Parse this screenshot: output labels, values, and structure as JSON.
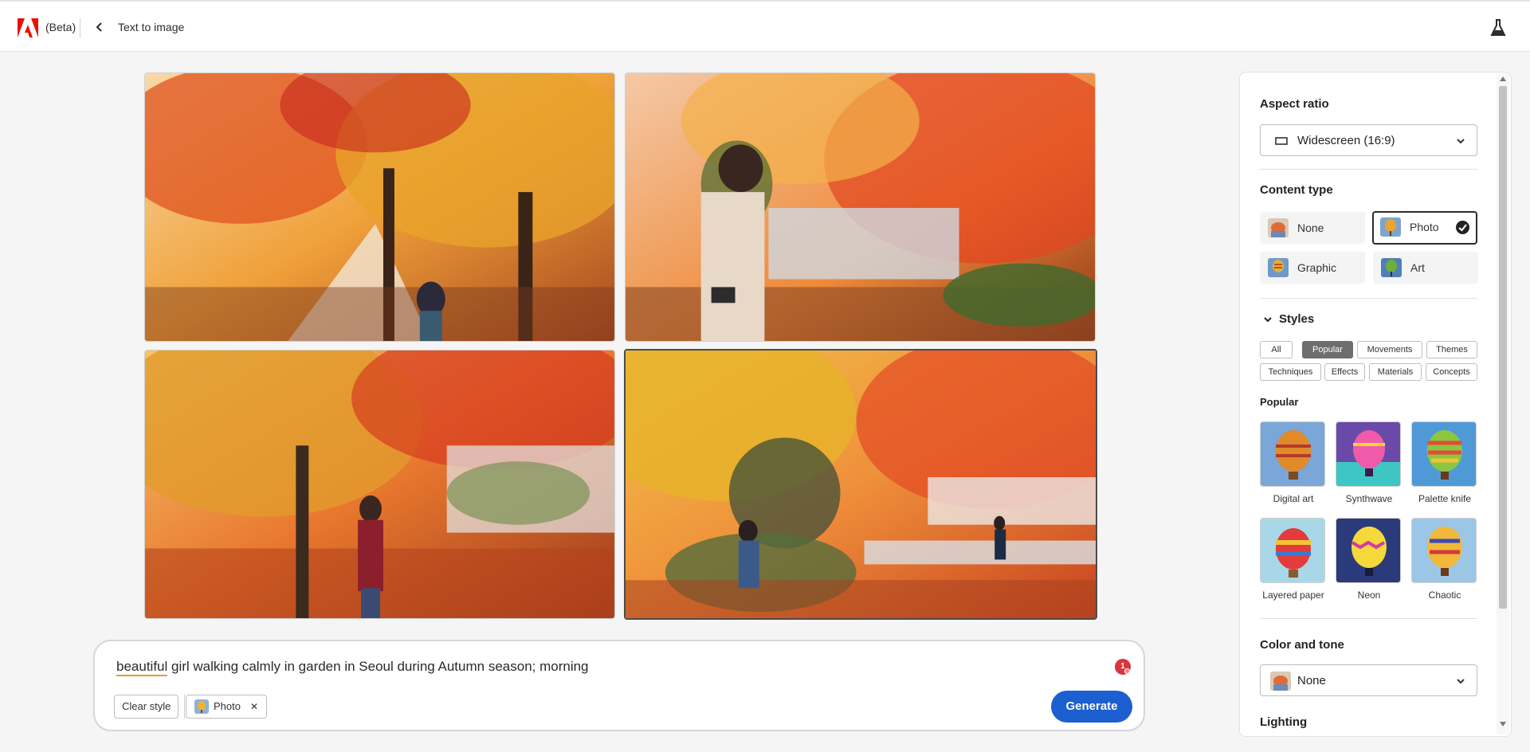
{
  "header": {
    "beta_label": "(Beta)",
    "page_title": "Text to image"
  },
  "gallery": {
    "images": [
      {
        "alt": "Autumn garden with woman among maple trees"
      },
      {
        "alt": "Woman with camera in autumn park"
      },
      {
        "alt": "Woman walking under red and orange maple trees"
      },
      {
        "alt": "Girl with backpack in autumn garden"
      }
    ]
  },
  "prompt": {
    "text_underlined": "beautiful",
    "text_rest": " girl walking calmly in garden in Seoul during Autumn season; morning",
    "notification_count": "1",
    "clear_style_label": "Clear style",
    "chip_photo_label": "Photo",
    "generate_label": "Generate"
  },
  "panel": {
    "aspect_ratio": {
      "title": "Aspect ratio",
      "value": "Widescreen (16:9)"
    },
    "content_type": {
      "title": "Content type",
      "options": [
        {
          "label": "None"
        },
        {
          "label": "Photo",
          "selected": true
        },
        {
          "label": "Graphic"
        },
        {
          "label": "Art"
        }
      ]
    },
    "styles": {
      "title": "Styles",
      "filters": [
        "All",
        "Popular",
        "Movements",
        "Themes",
        "Techniques",
        "Effects",
        "Materials",
        "Concepts"
      ],
      "active_filter": "Popular",
      "section_label": "Popular",
      "items": [
        "Digital art",
        "Synthwave",
        "Palette knife",
        "Layered paper",
        "Neon",
        "Chaotic"
      ]
    },
    "color_tone": {
      "title": "Color and tone",
      "value": "None"
    },
    "lighting": {
      "title": "Lighting"
    }
  },
  "colors": {
    "accent": "#1b5fd1",
    "brand_red": "#eb1000",
    "notification": "#d7373f"
  }
}
